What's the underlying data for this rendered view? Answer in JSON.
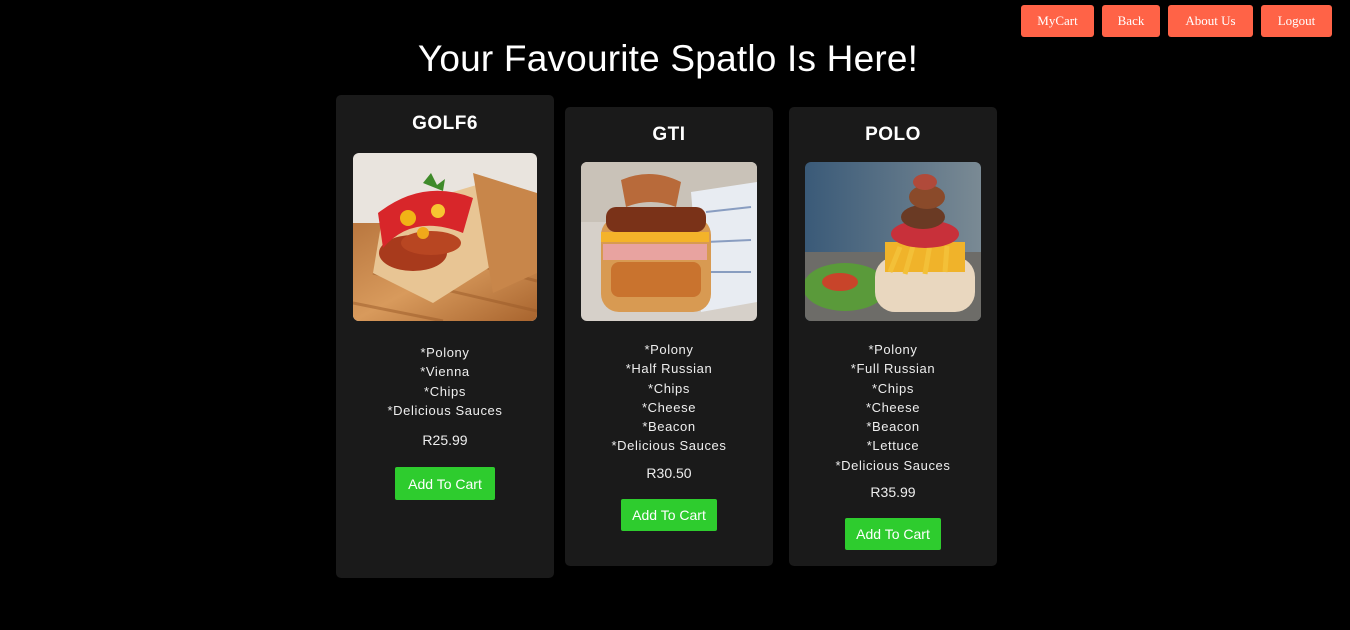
{
  "nav": {
    "items": [
      {
        "label": "MyCart"
      },
      {
        "label": "Back"
      },
      {
        "label": "About Us"
      },
      {
        "label": "Logout"
      }
    ]
  },
  "page_title": "Your Favourite Spatlo Is Here!",
  "products": [
    {
      "name": "GOLF6",
      "ingredients": [
        "*Polony",
        "*Vienna",
        "*Chips",
        "*Delicious Sauces"
      ],
      "price": "R25.99",
      "button_label": "Add To Cart"
    },
    {
      "name": "GTI",
      "ingredients": [
        "*Polony",
        "*Half Russian",
        "*Chips",
        "*Cheese",
        "*Beacon",
        "*Delicious Sauces"
      ],
      "price": "R30.50",
      "button_label": "Add To Cart"
    },
    {
      "name": "POLO",
      "ingredients": [
        "*Polony",
        "*Full Russian",
        "*Chips",
        "*Cheese",
        "*Beacon",
        "*Lettuce",
        "*Delicious Sauces"
      ],
      "price": "R35.99",
      "button_label": "Add To Cart"
    }
  ],
  "colors": {
    "background": "#000000",
    "card": "#1a1a1a",
    "nav_button": "#ff6347",
    "cart_button": "#2ecc2e"
  }
}
